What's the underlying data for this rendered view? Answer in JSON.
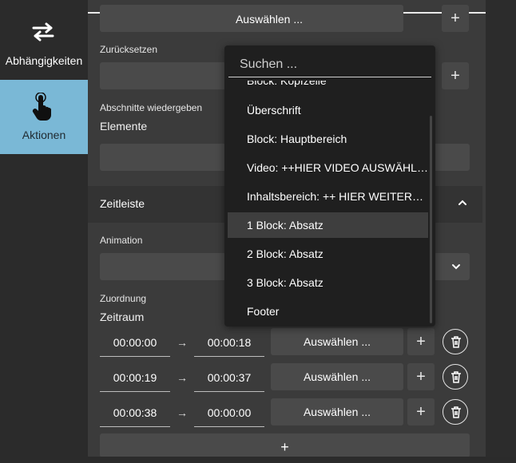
{
  "sidebar": {
    "items": [
      {
        "label": "Abhängigkeiten",
        "icon": "swap-arrows-icon",
        "active": false
      },
      {
        "label": "Aktionen",
        "icon": "touch-hand-icon",
        "active": true
      }
    ]
  },
  "top_select": {
    "value": "Auswählen ..."
  },
  "reset": {
    "label": "Zurücksetzen"
  },
  "sections_play": {
    "label": "Abschnitte wiedergeben",
    "title": "Elemente"
  },
  "timeline": {
    "title": "Zeitleiste"
  },
  "animation": {
    "label": "Animation"
  },
  "mapping": {
    "label": "Zuordnung",
    "title": "Zeitraum"
  },
  "time_rows": [
    {
      "start": "00:00:00",
      "end": "00:00:18",
      "select": "Auswählen ..."
    },
    {
      "start": "00:00:19",
      "end": "00:00:37",
      "select": "Auswählen ..."
    },
    {
      "start": "00:00:38",
      "end": "00:00:00",
      "select": "Auswählen ..."
    }
  ],
  "arrow_glyph": "→",
  "add_glyph": "+",
  "dropdown": {
    "placeholder": "Suchen ...",
    "items": [
      "Block: Kopfzeile",
      "Überschrift",
      "Block: Hauptbereich",
      "Video: ++HIER VIDEO AUSWÄHLEN++",
      "Inhaltsbereich: ++ HIER WEITERE INHALTE ++",
      "1 Block: Absatz",
      "2 Block: Absatz",
      "3 Block: Absatz",
      "Footer"
    ],
    "active_item": "1 Block: Absatz"
  },
  "colors": {
    "accent": "#7ab8d6",
    "panel": "#3b3b3b",
    "dropdown": "#1f1f1f"
  }
}
